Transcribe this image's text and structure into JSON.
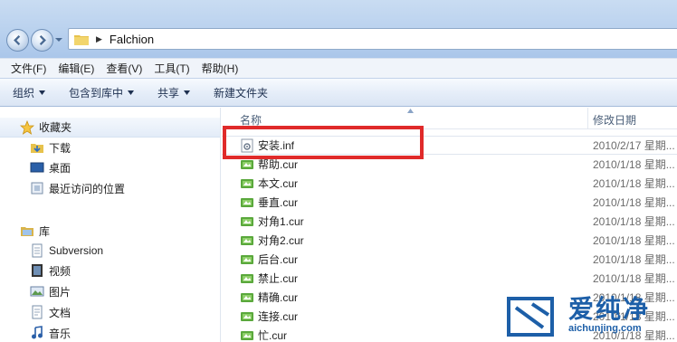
{
  "address": {
    "path_segment": "Falchion"
  },
  "menu": [
    "文件(F)",
    "编辑(E)",
    "查看(V)",
    "工具(T)",
    "帮助(H)"
  ],
  "toolbar": {
    "organize": "组织",
    "include_library": "包含到库中",
    "share": "共享",
    "new_folder": "新建文件夹"
  },
  "nav": {
    "favorites": "收藏夹",
    "fav_items": [
      "下载",
      "桌面",
      "最近访问的位置"
    ],
    "libraries": "库",
    "lib_items": [
      "Subversion",
      "视频",
      "图片",
      "文档",
      "音乐"
    ]
  },
  "columns": {
    "name": "名称",
    "date": "修改日期"
  },
  "files": [
    {
      "name": "安装.inf",
      "date": "2010/2/17 星期...",
      "icon": "settings-file-icon"
    },
    {
      "name": "帮助.cur",
      "date": "2010/1/18 星期...",
      "icon": "cursor-file-icon"
    },
    {
      "name": "本文.cur",
      "date": "2010/1/18 星期...",
      "icon": "cursor-file-icon"
    },
    {
      "name": "垂直.cur",
      "date": "2010/1/18 星期...",
      "icon": "cursor-file-icon"
    },
    {
      "name": "对角1.cur",
      "date": "2010/1/18 星期...",
      "icon": "cursor-file-icon"
    },
    {
      "name": "对角2.cur",
      "date": "2010/1/18 星期...",
      "icon": "cursor-file-icon"
    },
    {
      "name": "后台.cur",
      "date": "2010/1/18 星期...",
      "icon": "cursor-file-icon"
    },
    {
      "name": "禁止.cur",
      "date": "2010/1/18 星期...",
      "icon": "cursor-file-icon"
    },
    {
      "name": "精确.cur",
      "date": "2010/1/18 星期...",
      "icon": "cursor-file-icon"
    },
    {
      "name": "连接.cur",
      "date": "2010/1/18 星期...",
      "icon": "cursor-file-icon"
    },
    {
      "name": "忙.cur",
      "date": "2010/1/18 星期...",
      "icon": "cursor-file-icon"
    }
  ],
  "watermark": {
    "brand": "爱纯净",
    "url": "aichunjing.com"
  },
  "colors": {
    "highlight": "#e02a2a",
    "accent": "#1d5fa8"
  }
}
